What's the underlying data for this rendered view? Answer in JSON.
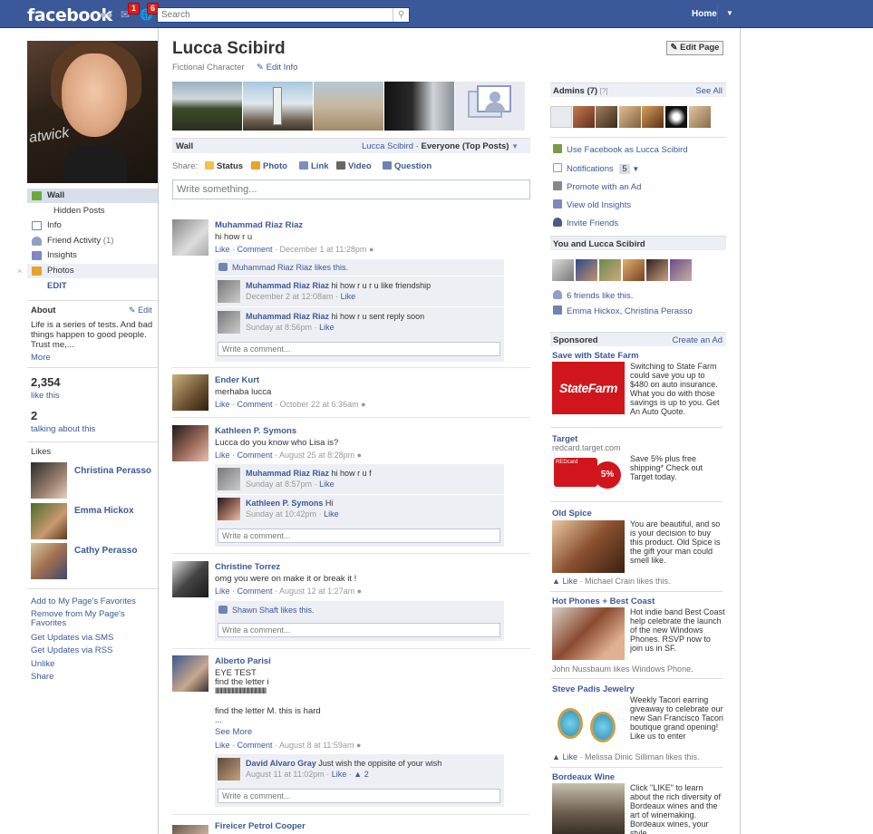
{
  "topbar": {
    "logo": "facebook",
    "friend_badge": "",
    "messages_badge": "1",
    "notif_badge": "6",
    "search_placeholder": "Search",
    "home": "Home"
  },
  "left": {
    "nav": [
      {
        "label": "Wall",
        "selected": true,
        "icon": "wall-icon"
      },
      {
        "label": "Hidden Posts",
        "indent": true
      },
      {
        "label": "Info",
        "icon": "info-icon"
      },
      {
        "label": "Friend Activity",
        "count": "(1)",
        "icon": "friends-icon"
      },
      {
        "label": "Insights",
        "icon": "insights-icon"
      },
      {
        "label": "Photos",
        "icon": "photos-icon"
      }
    ],
    "edit": "EDIT",
    "about_title": "About",
    "about_edit": "Edit",
    "about_text": "Life is a series of tests. And bad things happen to good people. Trust me,...",
    "about_more": "More",
    "likes_count": "2,354",
    "likes_label": "like this",
    "talking_count": "2",
    "talking_label": "talking about this",
    "likes_title": "Likes",
    "likes": [
      "Christina Perasso",
      "Emma Hickox",
      "Cathy Perasso"
    ],
    "links": [
      "Add to My Page's Favorites",
      "Remove from My Page's Favorites",
      "Get Updates via SMS",
      "Get Updates via RSS",
      "Unlike",
      "Share"
    ]
  },
  "page": {
    "name": "Lucca Scibird",
    "category": "Fictional Character",
    "edit_info": "Edit Info",
    "edit_page": "Edit Page",
    "wall": "Wall",
    "wall_owner": "Lucca Scibird",
    "wall_filter": "Everyone (Top Posts)",
    "share_label": "Share:",
    "share": [
      "Status",
      "Photo",
      "Link",
      "Video",
      "Question"
    ],
    "write_placeholder": "Write something...",
    "write_comment": "Write a comment..."
  },
  "posts": [
    {
      "author": "Muhammad Riaz Riaz",
      "text": "hi how r u",
      "meta": "December 1 at 11:28pm",
      "likes": "Muhammad Riaz Riaz likes this.",
      "comments": [
        {
          "author": "Muhammad Riaz Riaz",
          "text": "hi how r u r u like friendship",
          "meta": "December 2 at 12:08am"
        },
        {
          "author": "Muhammad Riaz Riaz",
          "text": "hi how r u sent reply soon",
          "meta": "Sunday at 8:56pm"
        }
      ]
    },
    {
      "author": "Ender Kurt",
      "text": "merhaba lucca",
      "meta": "October 22 at 6:36am"
    },
    {
      "author": "Kathleen P. Symons",
      "text": "Lucca do you know who Lisa is?",
      "meta": "August 25 at 8:28pm",
      "comments": [
        {
          "author": "Muhammad Riaz Riaz",
          "text": "hi how r u f",
          "meta": "Sunday at 8:57pm"
        },
        {
          "author": "Kathleen P. Symons",
          "text": "Hi",
          "meta": "Sunday at 10:42pm"
        }
      ]
    },
    {
      "author": "Christine Torrez",
      "text": "omg you were on make it or break it !",
      "meta": "August 12 at 1:27am",
      "likes": "Shawn Shaft likes this."
    },
    {
      "author": "Alberto Parisi",
      "text1": "EYE TEST",
      "text2": "find the letter i",
      "text3": "lllllllllllllllllllllllllllllllllllllllllll",
      "text4": "find the letter M. this is hard",
      "text5": "...",
      "see_more": "See More",
      "meta": "August 8 at 11:59am",
      "comments": [
        {
          "author": "David Alvaro Gray",
          "text": "Just wish the oppisite of your wish",
          "meta": "August 11 at 11:02pm",
          "likes": "2"
        }
      ]
    },
    {
      "author": "Fireicer Petrol Cooper"
    }
  ],
  "actions": {
    "like": "Like",
    "comment": "Comment",
    "dot": " · "
  },
  "right": {
    "admins_title": "Admins (7)",
    "admins_q": "[?]",
    "see_all": "See All",
    "actions": [
      "Use Facebook as Lucca Scibird",
      "Notifications",
      "Promote with an Ad",
      "View old Insights",
      "Invite Friends"
    ],
    "notif_count": "5",
    "you_and": "You and Lucca Scibird",
    "friends_like": "6 friends like this.",
    "friends_names": "Emma Hickox, Christina Perasso",
    "sponsored": "Sponsored",
    "create_ad": "Create an Ad",
    "ads": [
      {
        "title": "Save with State Farm",
        "logo": "StateFarm",
        "text": "Switching to State Farm could save you up to $480 on auto insurance. What you do with those savings is up to you. Get An Auto Quote."
      },
      {
        "title": "Target",
        "sub": "redcard.target.com",
        "text": "Save 5% plus free shipping* Check out Target today.",
        "card": "REDcard",
        "pct": "5%"
      },
      {
        "title": "Old Spice",
        "text": "You are beautiful, and so is your decision to buy this product. Old Spice is the gift your man could smell like.",
        "like": "Like",
        "liker": "Michael Crain likes this."
      },
      {
        "title": "Hot Phones + Best Coast",
        "text": "Hot indie band Best Coast help celebrate the launch of the new Windows Phones. RSVP now to join us in SF.",
        "liker": "John Nussbaum likes Windows Phone."
      },
      {
        "title": "Steve Padis Jewelry",
        "text": "Weekly Tacori earring giveaway to celebrate our new San Francisco Tacori boutique grand opening! Like us to enter",
        "like": "Like",
        "liker": "Melissa Dinic Silliman likes this."
      },
      {
        "title": "Bordeaux Wine",
        "text": "Click \"LIKE\" to learn about the rich diversity of Bordeaux wines and the art of winemaking. Bordeaux wines, your style."
      }
    ]
  }
}
